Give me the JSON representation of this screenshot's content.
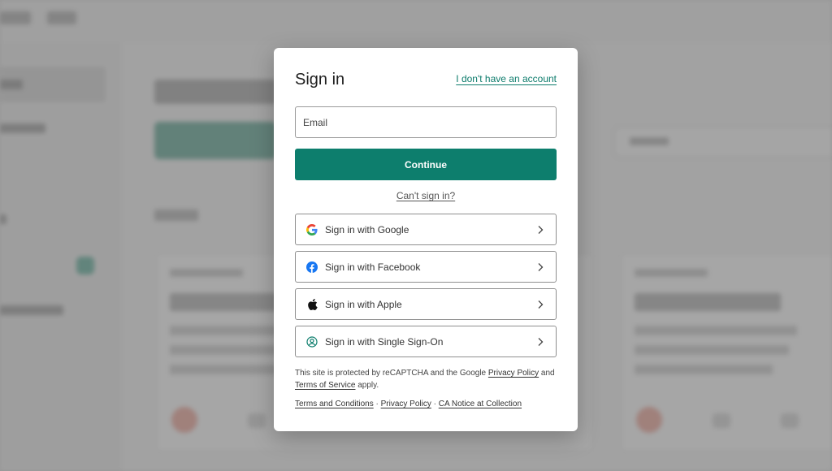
{
  "modal": {
    "title": "Sign in",
    "no_account_link": "I don't have an account",
    "email_placeholder": "Email",
    "continue_label": "Continue",
    "cant_sign_in": "Can't sign in?",
    "providers": [
      {
        "label": "Sign in with Google",
        "icon": "google-icon"
      },
      {
        "label": "Sign in with Facebook",
        "icon": "facebook-icon"
      },
      {
        "label": "Sign in with Apple",
        "icon": "apple-icon"
      },
      {
        "label": "Sign in with Single Sign-On",
        "icon": "sso-icon"
      }
    ],
    "legal": {
      "prefix": "This site is protected by reCAPTCHA and the Google ",
      "privacy_policy": "Privacy Policy",
      "and": " and ",
      "terms_of_service": "Terms of Service",
      "suffix": " apply."
    },
    "footer": {
      "terms": "Terms and Conditions",
      "separator": " · ",
      "privacy": "Privacy Policy",
      "ca_notice": "CA Notice at Collection"
    }
  },
  "colors": {
    "brand": "#0d7e6d",
    "link": "#0d7c6c",
    "overlay": "rgba(60,60,60,0.42)",
    "google_blue": "#4285F4",
    "google_red": "#EA4335",
    "google_yellow": "#FBBC05",
    "google_green": "#34A853",
    "facebook_blue": "#1877F2",
    "sso_teal": "#0d7e6d"
  }
}
